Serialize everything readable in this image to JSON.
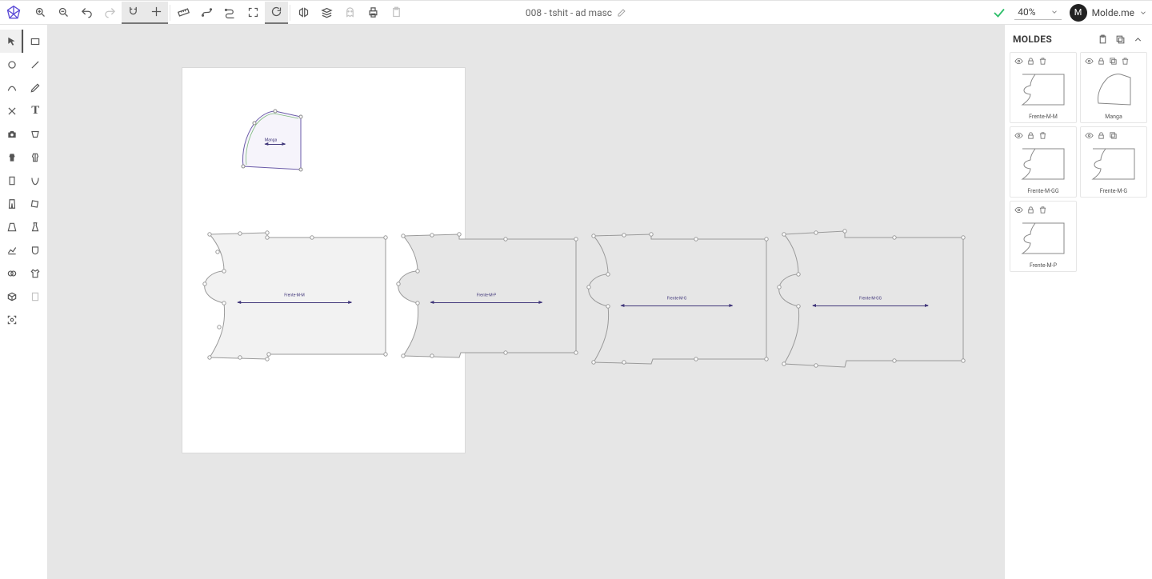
{
  "document_title": "008 - tshit - ad masc",
  "zoom": "40%",
  "user": {
    "name": "Molde.me",
    "initial": "M"
  },
  "panel_title": "MOLDES",
  "canvas": {
    "sleeve": {
      "label": "Manga",
      "sub": ""
    },
    "pieces": [
      {
        "label": "Frente-M-M"
      },
      {
        "label": "Frente-M-P"
      },
      {
        "label": "Frente-M-G"
      },
      {
        "label": "Frente-M-GG"
      }
    ]
  },
  "thumbs": [
    {
      "name": "Frente-M-M",
      "shape": "front",
      "tools": [
        "eye",
        "lock",
        "trash"
      ]
    },
    {
      "name": "Manga",
      "shape": "sleeve",
      "tools": [
        "eye",
        "lock",
        "copy",
        "trash"
      ]
    },
    {
      "name": "Frente-M-GG",
      "shape": "front",
      "tools": [
        "eye",
        "lock",
        "trash"
      ]
    },
    {
      "name": "Frente-M-G",
      "shape": "front",
      "tools": [
        "eye",
        "lock",
        "copy"
      ]
    },
    {
      "name": "Frente-M-P",
      "shape": "front",
      "tools": [
        "eye",
        "lock",
        "trash"
      ]
    }
  ]
}
